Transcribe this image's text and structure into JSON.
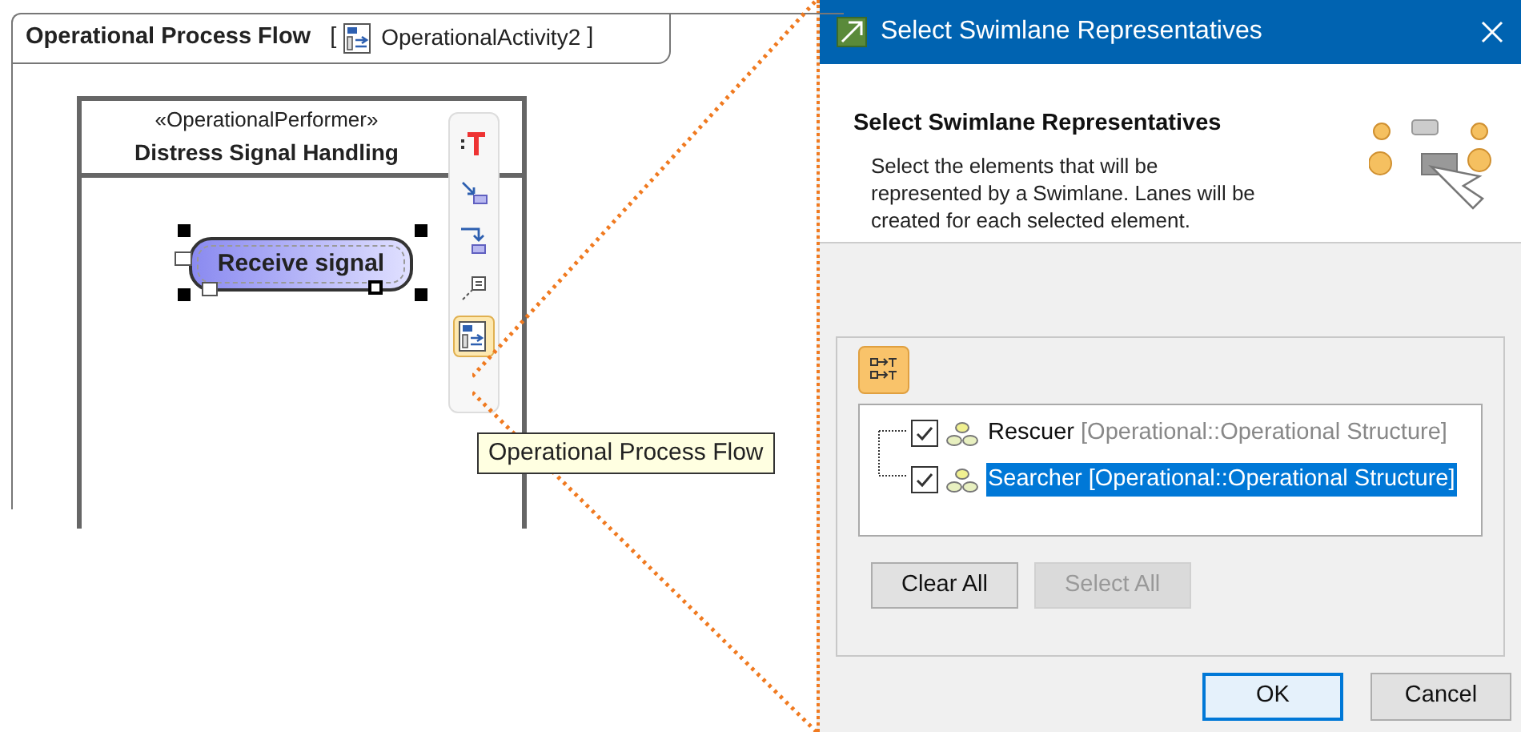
{
  "diagram": {
    "frame_title": "Operational Process Flow",
    "frame_bracket_open": "[",
    "diagram_name": "OperationalActivity2",
    "frame_bracket_close": "]",
    "lane": {
      "stereotype": "«OperationalPerformer»",
      "name": "Distress Signal Handling"
    },
    "action": {
      "label": "Receive signal",
      "selected": true
    },
    "smart_toolbar": [
      {
        "kind": "text",
        "selected": false
      },
      {
        "kind": "flow-out",
        "selected": false
      },
      {
        "kind": "flow-down",
        "selected": false
      },
      {
        "kind": "note",
        "selected": false
      },
      {
        "kind": "diagram",
        "selected": true
      }
    ],
    "tooltip": "Operational Process Flow"
  },
  "dialog": {
    "title": "Select Swimlane Representatives",
    "heading": "Select Swimlane Representatives",
    "description": "Select the elements that will be represented by a Swimlane. Lanes will be created for each selected element.",
    "tree": [
      {
        "name": "Rescuer",
        "qualifier": "[Operational::Operational Structure]",
        "checked": true,
        "selected": false
      },
      {
        "name": "Searcher",
        "qualifier": "[Operational::Operational Structure]",
        "checked": true,
        "selected": true
      }
    ],
    "buttons": [
      {
        "label": "Clear All",
        "disabled": false
      },
      {
        "label": "Select All",
        "disabled": true
      }
    ],
    "footer_buttons": [
      {
        "label": "OK",
        "default": true
      },
      {
        "label": "Cancel",
        "default": false
      }
    ]
  }
}
